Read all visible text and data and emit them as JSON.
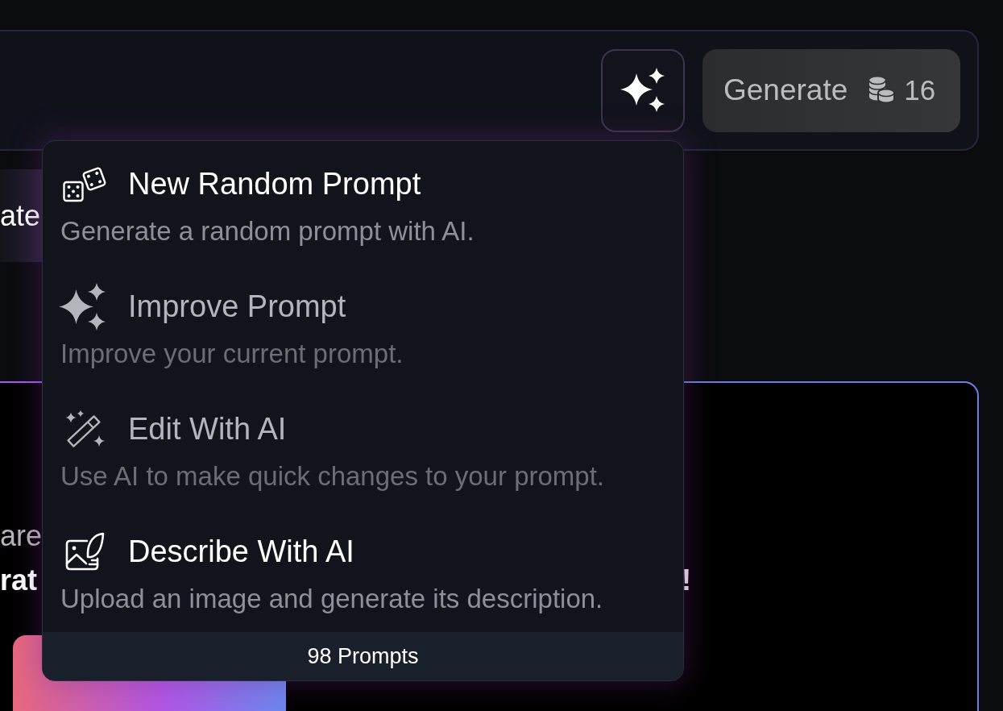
{
  "top_bar": {
    "generate_button": {
      "label": "Generate",
      "credits": "16"
    }
  },
  "side_tab": {
    "label": "ate"
  },
  "upgrade_card": {
    "line_1": "are",
    "line_2_start": "rat",
    "line_2_end": "!"
  },
  "ai_menu": {
    "items": [
      {
        "kind": "dice",
        "title": "New Random Prompt",
        "description": "Generate a random prompt with AI.",
        "disabled": false
      },
      {
        "kind": "sparkles",
        "title": "Improve Prompt",
        "description": "Improve your current prompt.",
        "disabled": true
      },
      {
        "kind": "magic-pencil",
        "title": "Edit With AI",
        "description": "Use AI to make quick changes to your prompt.",
        "disabled": true
      },
      {
        "kind": "image-feather",
        "title": "Describe With AI",
        "description": "Upload an image and generate its description.",
        "disabled": false
      }
    ],
    "footer": "98 Prompts"
  }
}
